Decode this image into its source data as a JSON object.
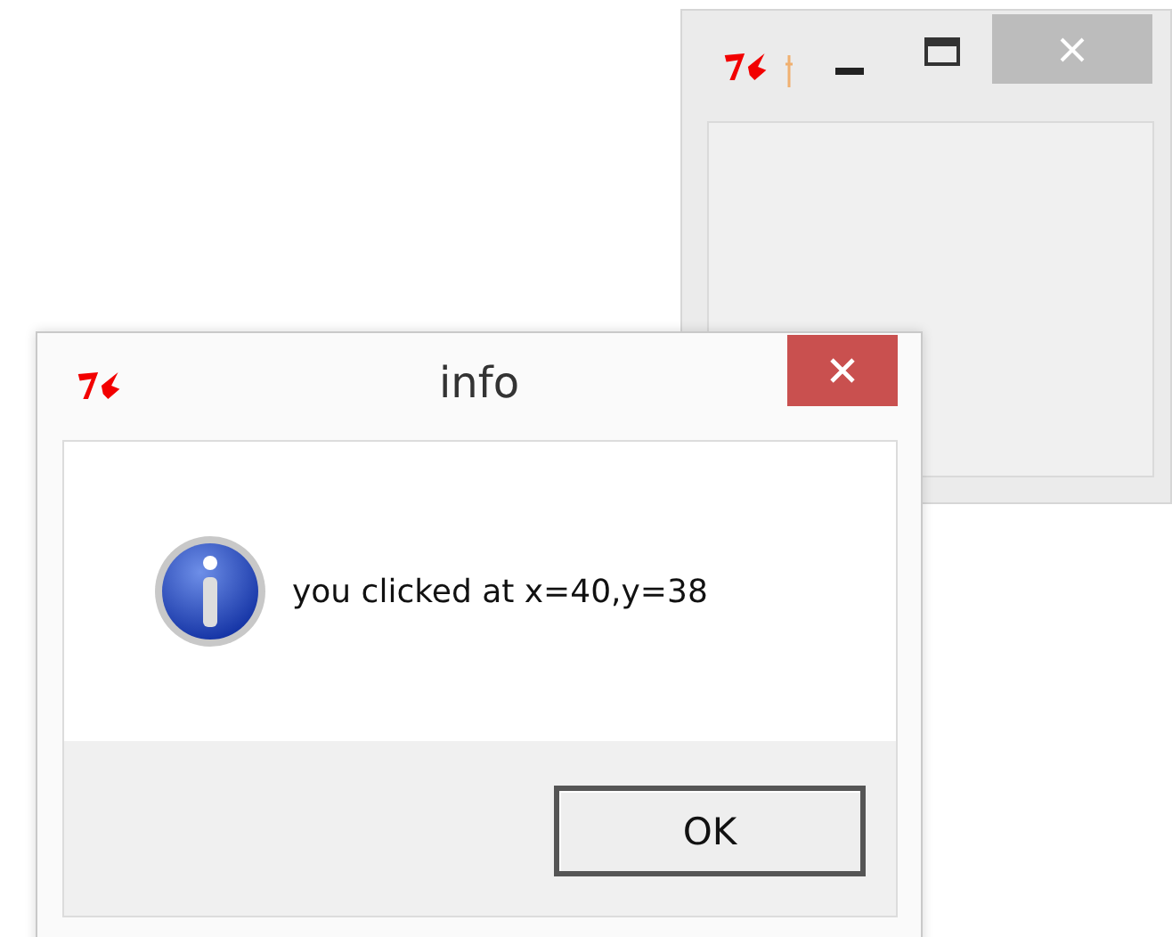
{
  "dialog": {
    "title": "info",
    "message": "you clicked at x=40,y=38",
    "buttons": [
      {
        "label": "OK",
        "default": true
      }
    ]
  }
}
